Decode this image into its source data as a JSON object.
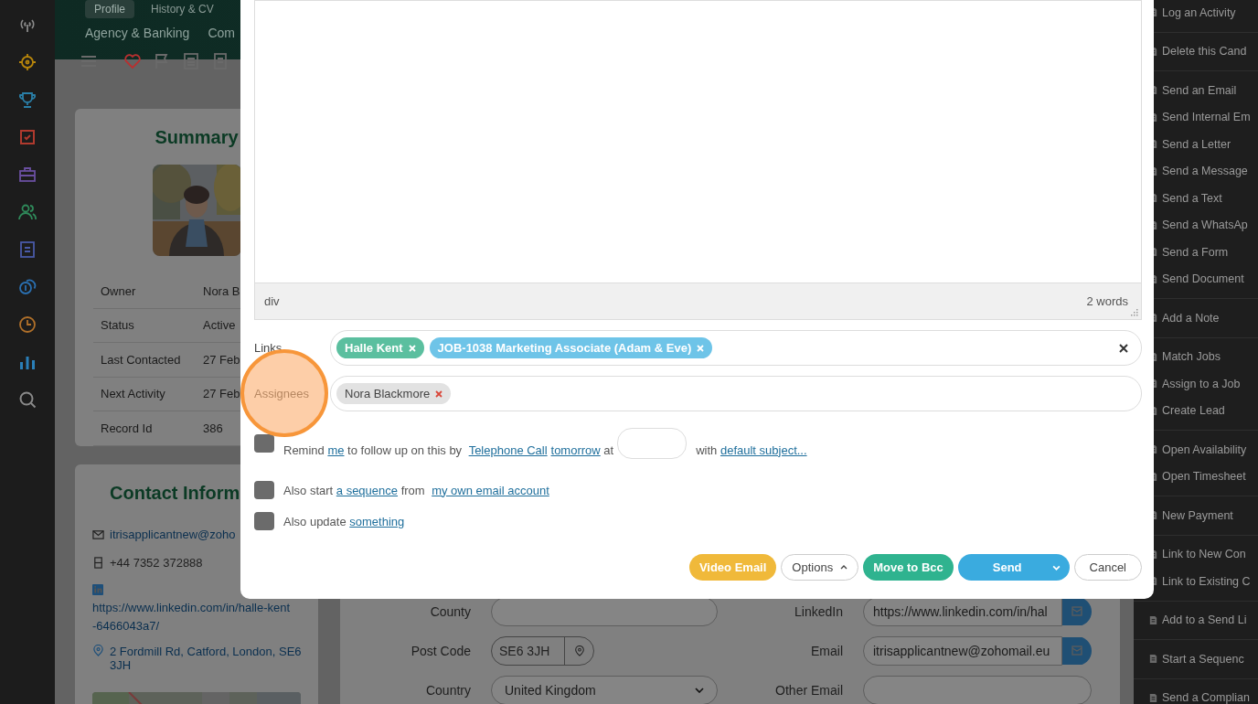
{
  "rail": [
    {
      "color": "#8a8a8a"
    },
    {
      "color": "#b8860b"
    },
    {
      "color": "#2a7fa8"
    },
    {
      "color": "#b03a2e"
    },
    {
      "color": "#6a4fa0"
    },
    {
      "color": "#2f8a5a"
    },
    {
      "color": "#4a5aa8"
    },
    {
      "color": "#2a6fb0"
    },
    {
      "color": "#b0702a"
    },
    {
      "color": "#2a7fb8"
    },
    {
      "color": "#8a8a8a"
    }
  ],
  "header": {
    "tabs": [
      {
        "label": "Profile",
        "selected": true
      },
      {
        "label": "History & CV",
        "selected": false
      }
    ],
    "sub_tabs": [
      "Agency & Banking",
      "Com"
    ]
  },
  "summary": {
    "title": "Summary",
    "rows": [
      {
        "label": "Owner",
        "value": "Nora B"
      },
      {
        "label": "Status",
        "value": "Active"
      },
      {
        "label": "Last Contacted",
        "value": "27 Feb"
      },
      {
        "label": "Next Activity",
        "value": "27 Feb"
      },
      {
        "label": "Record Id",
        "value": "386"
      }
    ]
  },
  "contact": {
    "title": "Contact Inform",
    "email": "itrisapplicantnew@zoho",
    "phone": "+44 7352 372888",
    "linkedin": "https://www.linkedin.com/in/halle-kent-6466043a7/",
    "address": "2 Fordmill Rd, Catford, London, SE6 3JH"
  },
  "form": {
    "rows": [
      {
        "label": "County",
        "value": "",
        "kind": "input",
        "label_2": "LinkedIn",
        "value_2": "https://www.linkedin.com/in/hal"
      },
      {
        "label": "Post Code",
        "value": "SE6 3JH",
        "kind": "postcode",
        "label_2": "Email",
        "value_2": "itrisapplicantnew@zohomail.eu"
      },
      {
        "label": "Country",
        "value": "United Kingdom",
        "kind": "select",
        "label_2": "Other Email",
        "value_2": ""
      }
    ]
  },
  "modal": {
    "editor": {
      "path": "div",
      "word_count": "2 words"
    },
    "links": {
      "label": "Links",
      "chips": [
        {
          "text": "Halle Kent",
          "color": "#5bbf9f"
        },
        {
          "text": "JOB-1038 Marketing Associate (Adam & Eve)",
          "color": "#6ec4e8"
        }
      ]
    },
    "assignees": {
      "label": "Assignees",
      "chips": [
        {
          "text": "Nora Blackmore",
          "color": "#e2e2e2"
        }
      ]
    },
    "options": [
      {
        "checked": false,
        "segments": [
          {
            "kind": "sentence",
            "parts": [
              {
                "kind": "text",
                "text": "Remind "
              },
              {
                "kind": "link",
                "text": "me"
              },
              {
                "kind": "text",
                "text": " to follow up on this by "
              },
              {
                "kind": "link",
                "text": "Telephone Call"
              },
              {
                "kind": "link",
                "text": "tomorrow"
              },
              {
                "kind": "text",
                "text": " at"
              }
            ]
          },
          {
            "kind": "field"
          },
          {
            "kind": "sentence",
            "parts": [
              {
                "kind": "text",
                "text": "with "
              },
              {
                "kind": "link",
                "text": "default subject..."
              }
            ]
          }
        ]
      },
      {
        "checked": false,
        "segments": [
          {
            "kind": "sentence",
            "parts": [
              {
                "kind": "text",
                "text": "Also start "
              },
              {
                "kind": "link",
                "text": "a sequence"
              },
              {
                "kind": "text",
                "text": " from "
              },
              {
                "kind": "link",
                "text": "my own email account"
              }
            ]
          }
        ]
      },
      {
        "checked": false,
        "segments": [
          {
            "kind": "sentence",
            "parts": [
              {
                "kind": "text",
                "text": "Also update "
              },
              {
                "kind": "link",
                "text": "something"
              }
            ]
          }
        ]
      }
    ],
    "buttons": [
      {
        "label": "Video Email",
        "kind": "filled",
        "color": "#f0b93a"
      },
      {
        "label": "Options",
        "kind": "menu"
      },
      {
        "label": "Move to Bcc",
        "kind": "filled",
        "color": "#2fb38f"
      },
      {
        "label": "Send",
        "kind": "split",
        "color": "#3aabdf"
      },
      {
        "label": "Cancel",
        "kind": "outline"
      }
    ]
  },
  "actions": [
    [
      {
        "label": "Log an Activity"
      }
    ],
    [
      {
        "label": "Delete this Cand"
      }
    ],
    [
      {
        "label": "Send an Email"
      },
      {
        "label": "Send Internal Em"
      },
      {
        "label": "Send a Letter"
      },
      {
        "label": "Send a Message"
      },
      {
        "label": "Send a Text"
      },
      {
        "label": "Send a WhatsAp"
      },
      {
        "label": "Send a Form"
      },
      {
        "label": "Send Document"
      }
    ],
    [
      {
        "label": "Add a Note"
      }
    ],
    [
      {
        "label": "Match Jobs"
      },
      {
        "label": "Assign to a Job"
      },
      {
        "label": "Create Lead"
      }
    ],
    [
      {
        "label": "Open Availability"
      },
      {
        "label": "Open Timesheet"
      }
    ],
    [
      {
        "label": "New Payment"
      }
    ],
    [
      {
        "label": "Link to New Con"
      },
      {
        "label": "Link to Existing C"
      }
    ],
    [
      {
        "label": "Add to a Send Li"
      }
    ],
    [
      {
        "label": "Start a Sequenc"
      }
    ],
    [
      {
        "label": "Send a Complian"
      }
    ]
  ]
}
